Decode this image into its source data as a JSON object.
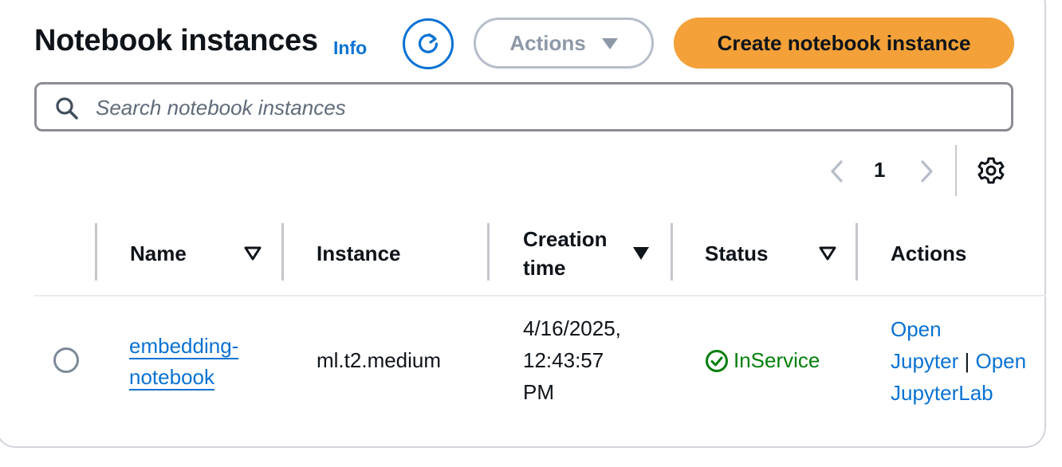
{
  "header": {
    "title": "Notebook instances",
    "info_link": "Info",
    "actions_label": "Actions",
    "create_label": "Create notebook instance"
  },
  "search": {
    "placeholder": "Search notebook instances",
    "value": ""
  },
  "pagination": {
    "current_page": "1"
  },
  "table": {
    "columns": {
      "name": "Name",
      "instance": "Instance",
      "creation_time_line1": "Creation",
      "creation_time_line2": "time",
      "status": "Status",
      "actions": "Actions"
    },
    "rows": [
      {
        "name_line1": "embedding-",
        "name_line2": "notebook",
        "instance": "ml.t2.medium",
        "creation_line1": "4/16/2025,",
        "creation_line2": "12:43:57",
        "creation_line3": "PM",
        "status": "InService",
        "action_open_line1": "Open",
        "action_jupyter": "Jupyter",
        "action_separator": "|",
        "action_open_line2": "Open",
        "action_jupyterlab": "JupyterLab"
      }
    ]
  },
  "icons": {
    "refresh": "refresh-icon",
    "caret": "caret-down-icon",
    "search": "search-icon",
    "prev": "chevron-left-icon",
    "next": "chevron-right-icon",
    "settings": "gear-icon",
    "status": "check-circle-icon",
    "sort": "sort-triangle-icon"
  },
  "colors": {
    "primary_button": "#f3a138",
    "link": "#0972d3",
    "status_success": "#037f0c",
    "disabled": "#8d99a8"
  }
}
